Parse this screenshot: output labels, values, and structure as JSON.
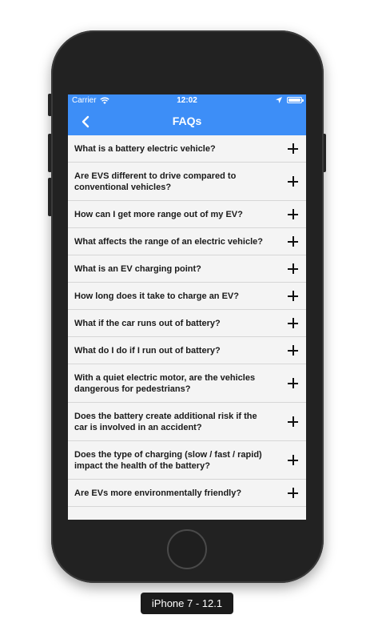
{
  "device": {
    "label": "iPhone 7 - 12.1"
  },
  "status_bar": {
    "carrier": "Carrier",
    "time": "12:02",
    "icons": [
      "wifi-icon",
      "location-icon",
      "battery-icon"
    ]
  },
  "nav": {
    "title": "FAQs",
    "back_icon": "chevron-left-icon"
  },
  "colors": {
    "accent": "#3d8ef7",
    "list_background": "#f4f4f4",
    "divider": "#d6d6d6"
  },
  "faqs": [
    {
      "question": "What is a battery electric vehicle?"
    },
    {
      "question": "Are EVS different to drive compared to conventional vehicles?"
    },
    {
      "question": "How can I get more range out of my EV?"
    },
    {
      "question": "What affects the range of an electric vehicle?"
    },
    {
      "question": "What is an EV charging point?"
    },
    {
      "question": "How long does it take to charge an EV?"
    },
    {
      "question": "What if the car runs out of battery?"
    },
    {
      "question": "What do I do if I run out of battery?"
    },
    {
      "question": "With a quiet electric motor, are the vehicles dangerous for pedestrians?"
    },
    {
      "question": "Does the battery create additional risk if the car is involved in an accident?"
    },
    {
      "question": "Does the type of charging (slow / fast / rapid) impact the health of the battery?"
    },
    {
      "question": "Are EVs more environmentally friendly?"
    }
  ]
}
